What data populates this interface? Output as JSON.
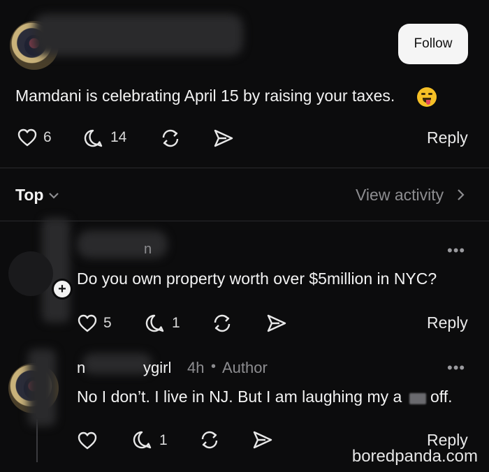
{
  "post": {
    "follow_label": "Follow",
    "text": "Mamdani is celebrating April 15 by raising your taxes.",
    "likes": "6",
    "comments": "14",
    "reply_label": "Reply"
  },
  "sort": {
    "label": "Top",
    "view_activity": "View activity"
  },
  "comments": [
    {
      "author_fragment": "n",
      "text": "Do you own property worth over $5million in NYC?",
      "likes": "5",
      "replies": "1",
      "reply_label": "Reply",
      "more": "•••"
    },
    {
      "author_start": "n",
      "author_end": "ygirl",
      "time": "4h",
      "separator": "•",
      "role": "Author",
      "text_before": "No I don’t. I live in NJ. But I am laughing my a",
      "text_after": "off.",
      "replies": "1",
      "reply_label": "Reply",
      "more": "•••"
    }
  ],
  "watermark": "boredpanda.com",
  "colors": {
    "background": "#0c0c0d",
    "text": "#f3f3f3",
    "muted": "#8d8d90",
    "follow_bg": "#f5f5f5"
  },
  "icons": [
    "heart-icon",
    "comment-icon",
    "repost-icon",
    "share-icon",
    "chevron-down-icon",
    "chevron-right-icon",
    "more-icon",
    "plus-icon"
  ]
}
